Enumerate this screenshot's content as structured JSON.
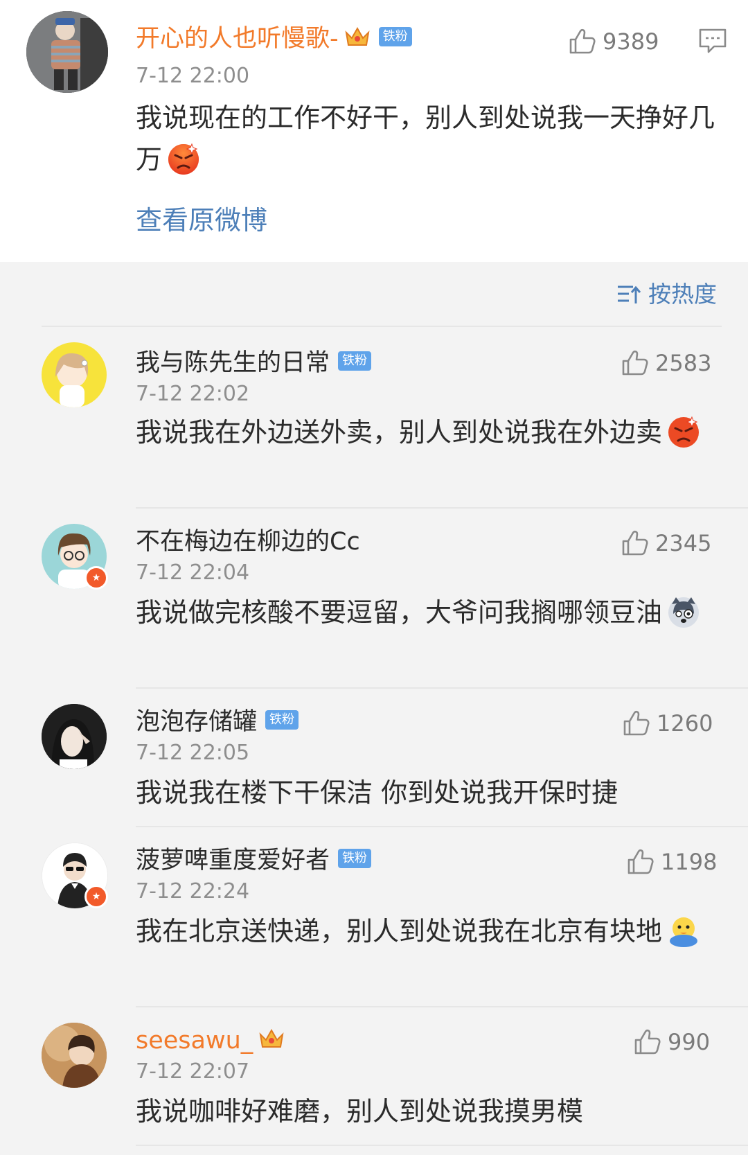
{
  "main_comment": {
    "username": "开心的人也听慢歌-",
    "badge": "铁粉",
    "time": "7-12 22:00",
    "likes": "9389",
    "content": "我说现在的工作不好干，别人到处说我一天挣好几万",
    "view_original": "查看原微博",
    "emoji": "angry-face-icon"
  },
  "sort": {
    "label": "按热度"
  },
  "replies": [
    {
      "username": "我与陈先生的日常",
      "badge": "铁粉",
      "time": "7-12 22:02",
      "likes": "2583",
      "content": "我说我在外边送外卖，别人到处说我在外边卖",
      "emoji": "angry-face-icon"
    },
    {
      "username": "不在梅边在柳边的Cc",
      "badge": "",
      "time": "7-12 22:04",
      "likes": "2345",
      "content": "我说做完核酸不要逗留，大爷问我搁哪领豆油",
      "emoji": "husky-face-icon"
    },
    {
      "username": "泡泡存储罐",
      "badge": "铁粉",
      "time": "7-12 22:05",
      "likes": "1260",
      "content": "我说我在楼下干保洁 你到处说我开保时捷",
      "emoji": ""
    },
    {
      "username": "菠萝啤重度爱好者",
      "badge": "铁粉",
      "time": "7-12 22:24",
      "likes": "1198",
      "content": "我在北京送快递，别人到处说我在北京有块地",
      "emoji": "chick-face-icon"
    },
    {
      "username": "seesawu_",
      "badge": "",
      "time": "7-12 22:07",
      "likes": "990",
      "content": "我说咖啡好难磨，别人到处说我摸男模",
      "emoji": ""
    }
  ],
  "colors": {
    "username_vip": "#f27a2a",
    "link": "#4d7fb8",
    "badge": "#5fa3ea"
  }
}
